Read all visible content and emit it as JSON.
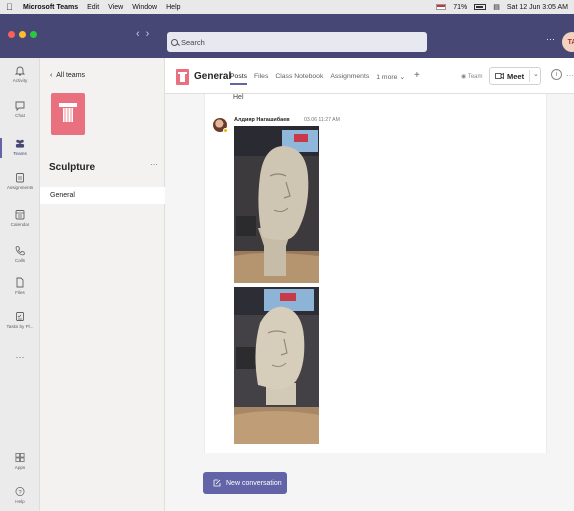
{
  "menubar": {
    "app": "Microsoft Teams",
    "menus": [
      "Edit",
      "View",
      "Window",
      "Help"
    ],
    "battery": "71%",
    "clock": "Sat 12 Jun  3:05 AM"
  },
  "titlebar": {
    "search_placeholder": "Search",
    "more": "···",
    "avatar_initials": "TA"
  },
  "rail": [
    {
      "label": "Activity",
      "icon": "bell-icon"
    },
    {
      "label": "Chat",
      "icon": "chat-icon"
    },
    {
      "label": "Teams",
      "icon": "teams-icon",
      "active": true
    },
    {
      "label": "Assignments",
      "icon": "assignments-icon"
    },
    {
      "label": "Calendar",
      "icon": "calendar-icon"
    },
    {
      "label": "Calls",
      "icon": "phone-icon"
    },
    {
      "label": "Files",
      "icon": "file-icon"
    },
    {
      "label": "Tasks by Pl...",
      "icon": "tasks-icon"
    },
    {
      "label": "···",
      "icon": "more-icon"
    },
    {
      "label": "Apps",
      "icon": "apps-icon"
    },
    {
      "label": "Help",
      "icon": "help-icon"
    }
  ],
  "teams_panel": {
    "back_label": "All teams",
    "team_name": "Sculpture",
    "team_more": "···",
    "channels": [
      "General"
    ]
  },
  "channel": {
    "name": "General",
    "tabs": [
      "Posts",
      "Files",
      "Class Notebook",
      "Assignments",
      "1 more"
    ],
    "active_tab": "Posts",
    "add": "+",
    "team_label": "Team",
    "meet_label": "Meet",
    "accent": "#6264a7"
  },
  "feed": {
    "previous_text": "Hel",
    "post": {
      "author": "Алдияр Нагашибаев",
      "time": "03.06 11:27 AM"
    }
  },
  "composer": {
    "label": "New conversation"
  },
  "colors": {
    "titlebar": "#464775",
    "brand": "#6264a7",
    "team_logo": "#e9707e"
  }
}
